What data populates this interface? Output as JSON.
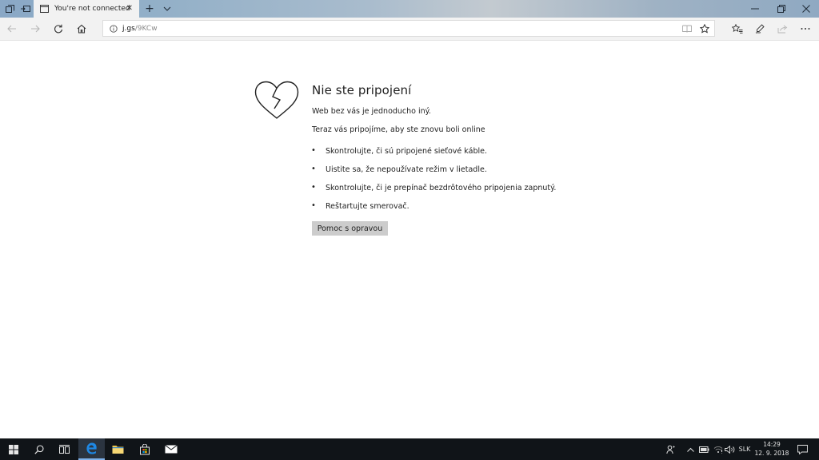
{
  "browser": {
    "tab": {
      "title": "You're not connected"
    },
    "address": {
      "host": "j.gs",
      "path": "/9KCw"
    }
  },
  "page": {
    "title": "Nie ste pripojení",
    "subtitle": "Web bez vás je jednoducho iný.",
    "intro": "Teraz vás pripojíme, aby ste znovu boli online",
    "tips": [
      "Skontrolujte, či sú pripojené sieťové káble.",
      "Uistite sa, že nepoužívate režim v lietadle.",
      "Skontrolujte, či je prepínač bezdrôtového pripojenia zapnutý.",
      "Reštartujte smerovač."
    ],
    "help_button": "Pomoc s opravou"
  },
  "taskbar": {
    "language": "SLK",
    "time": "14:29",
    "date": "12. 9. 2018"
  },
  "colors": {
    "tab_bg": "#f2f2f2",
    "taskbar_bg": "#101418",
    "button_bg": "#cccccc",
    "edge_blue": "#1e88e5"
  },
  "icons": [
    "back-icon",
    "forward-icon",
    "refresh-icon",
    "home-icon",
    "broken-heart-icon",
    "windows-start-icon",
    "search-icon",
    "edge-icon",
    "file-explorer-icon",
    "store-icon",
    "mail-icon"
  ]
}
